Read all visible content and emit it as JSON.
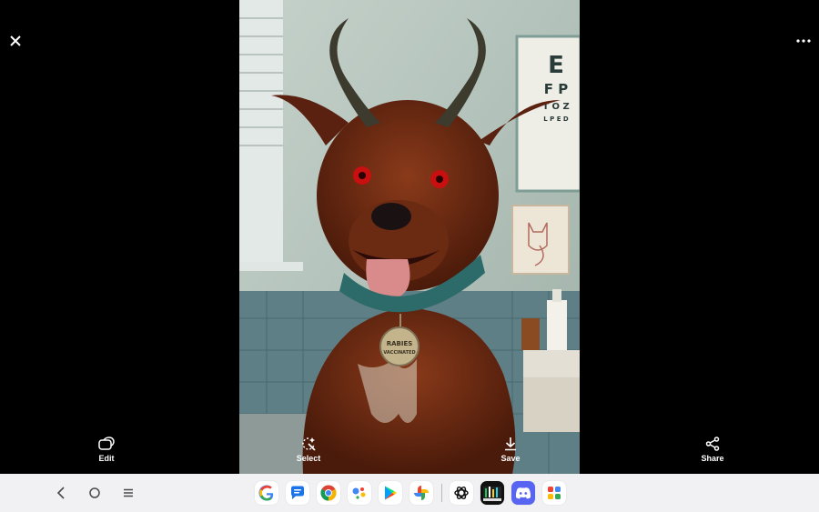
{
  "viewer": {
    "close_icon": "close-icon",
    "more_icon": "more-vert-icon",
    "photo_tag": {
      "line1": "RABIES",
      "line2": "VACCINATED"
    },
    "eye_chart_letters": [
      "E",
      "F P",
      "T O Z",
      "L P E D"
    ]
  },
  "actions": [
    {
      "label": "Edit",
      "icon": "edit-icon"
    },
    {
      "label": "Select",
      "icon": "select-icon"
    },
    {
      "label": "Save",
      "icon": "download-icon"
    },
    {
      "label": "Share",
      "icon": "share-icon"
    }
  ],
  "taskbar": {
    "nav": [
      "back-icon",
      "home-icon",
      "recents-icon"
    ],
    "apps": [
      "google",
      "messages",
      "chrome",
      "assistant",
      "play-store",
      "photos",
      "chatgpt",
      "piano",
      "discord",
      "app-grid"
    ]
  },
  "colors": {
    "accent": "#5865F2",
    "background": "#000000",
    "taskbar": "#f1f1f3"
  }
}
